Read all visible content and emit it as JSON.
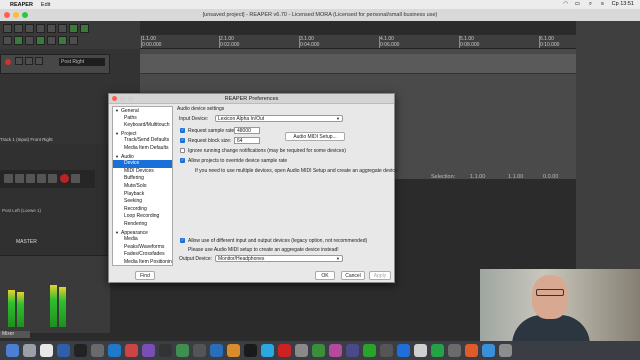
{
  "menubar": {
    "items": [
      "REAPER",
      "Edit"
    ],
    "clock": "Ср 13:51",
    "status_icons": [
      "wifi-icon",
      "battery-icon",
      "search-icon",
      "control-center-icon"
    ]
  },
  "window": {
    "title": "[unsaved project] - REAPER v6.70 - Licensed MORA (Licensed for personal/small business use)"
  },
  "ruler": {
    "marks": [
      "1.1.00",
      "2.1.00",
      "3.1.00",
      "4.1.00",
      "5.1.00",
      "6.1.00"
    ],
    "subtimes": [
      "0:00.000",
      "0:02.000",
      "0:04.000",
      "0:06.000",
      "0:08.000",
      "0:10.000"
    ]
  },
  "track": {
    "name": "Post Right",
    "info": "Track 1 (Input) Front Right",
    "mixer_label": "Post Left (Loewe 1)"
  },
  "selection": {
    "label": "Selection:",
    "start": "1.1.00",
    "end": "1.1.00",
    "length": "0.0.00"
  },
  "mixer": {
    "master_label": "MASTER",
    "tab_label": "Mixer",
    "meter_levels": [
      0.62,
      0.58,
      0.7,
      0.66
    ]
  },
  "prefs": {
    "title": "REAPER Preferences",
    "tree": [
      {
        "label": "General",
        "level": 0,
        "expanded": true
      },
      {
        "label": "Paths",
        "level": 1
      },
      {
        "label": "Keyboard/Multitouch",
        "level": 1
      },
      {
        "label": "Project",
        "level": 0,
        "expanded": true
      },
      {
        "label": "Track/Send Defaults",
        "level": 1
      },
      {
        "label": "Media Item Defaults",
        "level": 1
      },
      {
        "label": "Audio",
        "level": 0,
        "expanded": true
      },
      {
        "label": "Device",
        "level": 1,
        "selected": true
      },
      {
        "label": "MIDI Devices",
        "level": 1
      },
      {
        "label": "Buffering",
        "level": 1
      },
      {
        "label": "Mute/Solo",
        "level": 1
      },
      {
        "label": "Playback",
        "level": 1
      },
      {
        "label": "Seeking",
        "level": 1
      },
      {
        "label": "Recording",
        "level": 1
      },
      {
        "label": "Loop Recording",
        "level": 1
      },
      {
        "label": "Rendering",
        "level": 1
      },
      {
        "label": "Appearance",
        "level": 0,
        "expanded": true
      },
      {
        "label": "Media",
        "level": 1
      },
      {
        "label": "Peaks/Waveforms",
        "level": 1
      },
      {
        "label": "Fades/Crossfades",
        "level": 1
      },
      {
        "label": "Media Item Positioning",
        "level": 1
      },
      {
        "label": "Track Control Panels",
        "level": 1
      }
    ],
    "section_title": "Audio device settings",
    "input_device_label": "Input Device:",
    "input_device_value": "Lexicon Alpha In/Out",
    "sample_rate_label": "Request sample rate:",
    "sample_rate_value": "48000",
    "block_size_label": "Request block size:",
    "block_size_value": "64",
    "midi_setup_button": "Audio MIDI Setup...",
    "ignore_label": "Ignore running change notifications (may be required for some devices)",
    "allow_override_label": "Allow projects to override device sample rate",
    "aggregate_note": "If you need to use multiple devices, open Audio MIDI Setup and create an aggregate device.",
    "allow_legacy_label": "Allow use of different input and output devices (legacy option, not recommended)",
    "legacy_note": "Please use Audio MIDI setup to create an aggregate device instead!",
    "output_device_label": "Output Device:",
    "output_device_value": "Monitor/Headphones",
    "find_button": "Find",
    "ok_button": "OK",
    "cancel_button": "Cancel",
    "apply_button": "Apply"
  }
}
